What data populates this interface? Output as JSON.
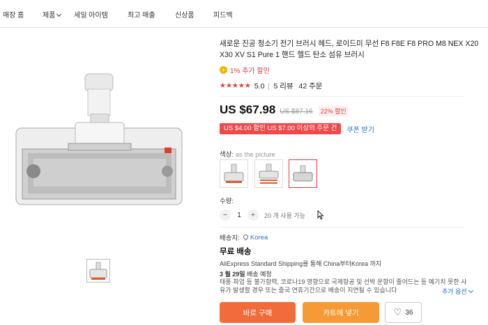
{
  "nav": {
    "items": [
      "매장 홈",
      "제품",
      "세일 아이템",
      "최고 매출",
      "신상품",
      "피드백"
    ]
  },
  "product": {
    "title": "새로운 진공 청소기 전기 브러시 헤드, 로이드미 무선 F8 F8E F8 PRO M8 NEX X20 X30 XV S1 Pure 1 핸드 헬드 탄소 섬유 브러시",
    "extra_discount": "1% 추가 할인",
    "coin_icon": "coin-icon",
    "stars": "★★★★★",
    "rating": "5.0",
    "reviews": "5 리뷰",
    "orders": "42 주문",
    "price": "US $67.98",
    "old_price": "US $87.16",
    "discount_badge": "22% 할인",
    "coupon": "US $4.00 할인 US $7.00 이상의 주문 건",
    "get_coupon": "쿠폰 받기",
    "color_label": "색상:",
    "color_value": "as the picture",
    "qty_label": "수량:",
    "qty_minus": "−",
    "qty_value": "1",
    "qty_plus": "+",
    "qty_available": "20 개 사용 가능",
    "ship_to_label": "배송지:",
    "ship_to": "Korea",
    "free_shipping": "무료 배송",
    "via": "AliExpress Standard Shipping를 통해 China부터Korea 까지",
    "eta_date": "3 월 29일",
    "eta_suffix": " 배송 예정",
    "notice": "태풍·파업 등 불가항력, 코로나19 영향으로 국제항공 및 선박 운항이 줄어드는 등 예기치 못한 사유가 발생할 경우 또는 중국 연휴기간으로 배송이 지연될 수 있습니다",
    "more_options": "추가 옵션",
    "buy_now": "바로 구매",
    "add_to_cart": "카트에 넣기",
    "wishlist_count": "36"
  },
  "colors": {
    "accent_red": "#e4393c",
    "buy_button": "#f26b3a",
    "cart_button": "#f59a34",
    "link_blue": "#2673c9"
  }
}
